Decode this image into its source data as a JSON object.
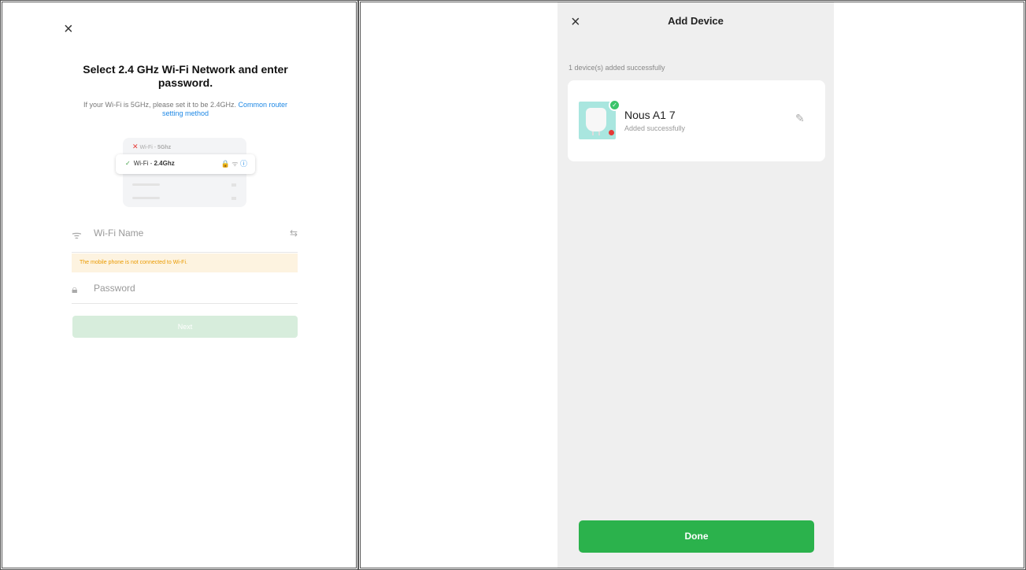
{
  "left": {
    "close_icon": "×",
    "title": "Select 2.4 GHz Wi-Fi Network and enter password.",
    "subtitle": "If your Wi-Fi is 5GHz, please set it to be 2.4GHz.",
    "subtitle_link": "Common router setting method",
    "illustration": {
      "bad_network_prefix": "Wi-Fi - ",
      "bad_network_band": "5Ghz",
      "good_network_prefix": "Wi-Fi - ",
      "good_network_band": "2.4Ghz"
    },
    "wifi_field": {
      "icon": "wifi-icon",
      "placeholder": "Wi-Fi Name"
    },
    "warning": "The mobile phone is not connected to Wi-Fi.",
    "password_field": {
      "icon": "lock-icon",
      "placeholder": "Password"
    },
    "next_label": "Next"
  },
  "right": {
    "close_icon": "×",
    "title": "Add Device",
    "added_count": "1 device(s) added successfully",
    "device": {
      "name": "Nous A1   7",
      "status": "Added successfully"
    },
    "done_label": "Done"
  },
  "colors": {
    "accent_green": "#2bb24c",
    "link_blue": "#1e88e5",
    "warning_bg": "#fdf3e0",
    "warning_text": "#ea9a00",
    "phone_bg": "#efefef"
  }
}
